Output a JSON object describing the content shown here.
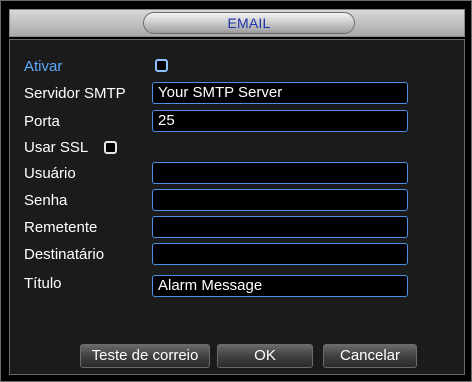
{
  "window": {
    "title": "EMAIL"
  },
  "form": {
    "enable_label": "Ativar",
    "smtp_server_label": "Servidor SMTP",
    "smtp_server_value": "Your SMTP Server",
    "port_label": "Porta",
    "port_value": "25",
    "ssl_label": "Usar SSL",
    "username_label": "Usuário",
    "username_value": "",
    "password_label": "Senha",
    "password_value": "",
    "sender_label": "Remetente",
    "sender_value": "",
    "recipient_label": "Destinatário",
    "recipient_value": "",
    "subject_label": "Título",
    "subject_value": "Alarm Message"
  },
  "buttons": {
    "test_label": "Teste de correio",
    "ok_label": "OK",
    "cancel_label": "Cancelar"
  },
  "colors": {
    "title_text": "#1d33a8",
    "active_label": "#5da9ff",
    "field_border": "#4d8fe8"
  }
}
